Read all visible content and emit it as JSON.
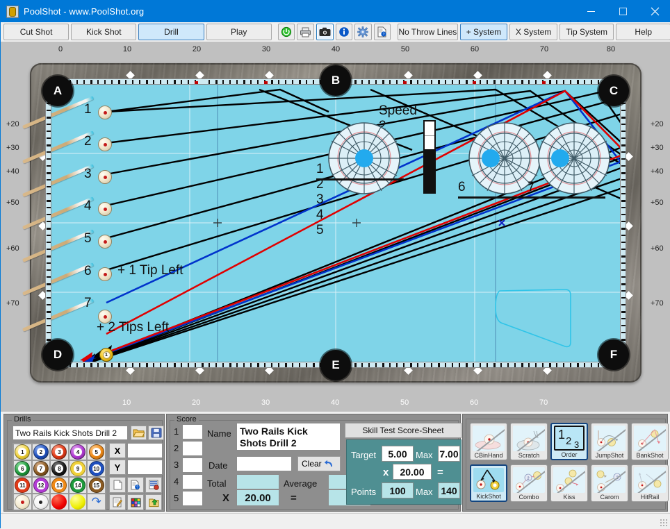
{
  "window": {
    "title": "PoolShot - www.PoolShot.org",
    "icon": "app-icon",
    "minimize": "–",
    "maximize": "□",
    "close": "✕"
  },
  "toolbar": {
    "tabs": [
      {
        "label": "Cut Shot",
        "selected": false
      },
      {
        "label": "Kick Shot",
        "selected": false
      },
      {
        "label": "Drill",
        "selected": true
      },
      {
        "label": "Play",
        "selected": false
      }
    ],
    "icons": [
      {
        "name": "power-icon",
        "glyph": "⏻",
        "color": "#19a519"
      },
      {
        "name": "printer-icon",
        "glyph": "⎙",
        "color": "#54585c"
      },
      {
        "name": "camera-icon",
        "glyph": "▣",
        "color": "#222222",
        "selected": true
      },
      {
        "name": "info-icon",
        "glyph": "i",
        "color": "#0a58c7"
      },
      {
        "name": "gear-icon",
        "glyph": "⚙",
        "color": "#4f7fd0"
      },
      {
        "name": "document-help-icon",
        "glyph": "?",
        "color": "#1b63c4"
      }
    ],
    "options": [
      {
        "label": "No Throw Lines",
        "selected": false
      },
      {
        "label": "+ System",
        "selected": true
      },
      {
        "label": "X System",
        "selected": false
      },
      {
        "label": "Tip System",
        "selected": false
      },
      {
        "label": "Help",
        "selected": false
      }
    ]
  },
  "table": {
    "ruler_top": [
      "0",
      "10",
      "20",
      "30",
      "40",
      "50",
      "60",
      "70",
      "80"
    ],
    "ruler_bottom": [
      "10",
      "20",
      "30",
      "40",
      "50",
      "60",
      "70"
    ],
    "ruler_left": [
      "+20",
      "+30",
      "+40",
      "+50",
      "+60",
      "+70"
    ],
    "ruler_right": [
      "+20",
      "+30",
      "+40",
      "+50",
      "+60",
      "+70"
    ],
    "pockets": [
      "A",
      "B",
      "C",
      "D",
      "E",
      "F"
    ],
    "cloth_color": "#7fd4e8",
    "rail_color": "#cfeaf2",
    "balls": [
      {
        "num": "1"
      },
      {
        "num": "2"
      },
      {
        "num": "3"
      },
      {
        "num": "4"
      },
      {
        "num": "5"
      },
      {
        "num": "6"
      },
      {
        "num": "7"
      }
    ],
    "object_ball": "1",
    "annotations": [
      {
        "text": "+ 1 Tip Left"
      },
      {
        "text": "+ 2 Tips Left"
      }
    ],
    "speed": {
      "label": "Speed 2",
      "value": 2,
      "max": 5
    },
    "spin_groups": [
      {
        "numbers": "1 2 3 4 5"
      },
      {
        "numbers": "6"
      },
      {
        "numbers": "7"
      }
    ],
    "line_colors": {
      "primary": "#000000",
      "alt1": "#0033cc",
      "alt2": "#e00000",
      "ghost": "#2fc4e8"
    }
  },
  "drills": {
    "group_label": "Drills",
    "name_value": "Two Rails Kick Shots Drill 2",
    "open_icon": "folder-open-icon",
    "save_icon": "floppy-save-icon",
    "balls": [
      {
        "label": "1",
        "color": "#f0d23c",
        "stripe": false
      },
      {
        "label": "2",
        "color": "#1f4fbe",
        "stripe": false
      },
      {
        "label": "3",
        "color": "#e03a18",
        "stripe": false
      },
      {
        "label": "4",
        "color": "#b23bd4",
        "stripe": false
      },
      {
        "label": "5",
        "color": "#f08a18",
        "stripe": false
      },
      {
        "label": "6",
        "color": "#1f9a3c",
        "stripe": false
      },
      {
        "label": "7",
        "color": "#8a5a22",
        "stripe": false
      },
      {
        "label": "8",
        "color": "#1c1c1c",
        "stripe": false
      },
      {
        "label": "9",
        "color": "#f0d23c",
        "stripe": true
      },
      {
        "label": "10",
        "color": "#1f4fbe",
        "stripe": true
      },
      {
        "label": "11",
        "color": "#e03a18",
        "stripe": true
      },
      {
        "label": "12",
        "color": "#b23bd4",
        "stripe": true
      },
      {
        "label": "13",
        "color": "#f08a18",
        "stripe": true
      },
      {
        "label": "14",
        "color": "#1f9a3c",
        "stripe": true
      },
      {
        "label": "15",
        "color": "#8a5a22",
        "stripe": true
      },
      {
        "label": "",
        "color": "#fdf6e0",
        "stripe": false
      },
      {
        "label": "",
        "color": "#f6f6f6",
        "stripe": false
      },
      {
        "label": "",
        "color": "#ee0000",
        "stripe": false
      },
      {
        "label": "",
        "color": "#eeee00",
        "stripe": false
      },
      {
        "label": "↷",
        "color": "#dcdcdc",
        "stripe": false
      }
    ],
    "x_label": "X",
    "y_label": "Y",
    "x_value": "",
    "y_value": "",
    "tools": [
      {
        "name": "new-document-icon"
      },
      {
        "name": "document-help-icon"
      },
      {
        "name": "table-report-icon"
      },
      {
        "name": "edit-note-icon"
      },
      {
        "name": "color-palette-icon"
      },
      {
        "name": "export-folder-icon"
      }
    ]
  },
  "score": {
    "group_label": "Score",
    "rows": [
      "1",
      "2",
      "3",
      "4",
      "5"
    ],
    "row_values": [
      "",
      "",
      "",
      "",
      ""
    ],
    "name_label": "Name",
    "name_value": "Two Rails Kick Shots Drill 2",
    "date_label": "Date",
    "date_value": "",
    "clear_label": "Clear",
    "clear_icon": "undo-arrow-icon",
    "total_label": "Total",
    "total_value": "",
    "average_label": "Average",
    "average_value": "",
    "multiply_label": "X",
    "multiplier_value": "20.00",
    "equals_label": "=",
    "result_value": ""
  },
  "skill_test": {
    "title": "Skill Test Score-Sheet",
    "target_label": "Target",
    "target_value": "5.00",
    "target_max_label": "Max",
    "target_max_value": "7.00",
    "multiply_label": "x",
    "multiplier_value": "20.00",
    "equals_label": "=",
    "points_label": "Points",
    "points_value": "100",
    "points_max_label": "Max",
    "points_max_value": "140",
    "panel_color": "#4f8f92"
  },
  "shot_types": [
    {
      "label": "CBinHand",
      "selected": false,
      "disabled": true
    },
    {
      "label": "Scratch",
      "selected": false,
      "disabled": true
    },
    {
      "label": "Order",
      "selected": true,
      "disabled": false
    },
    {
      "label": "JumpShot",
      "selected": false,
      "disabled": true
    },
    {
      "label": "BankShot",
      "selected": false,
      "disabled": true
    },
    {
      "label": "KickShot",
      "selected": true,
      "disabled": false
    },
    {
      "label": "Combo",
      "selected": false,
      "disabled": true
    },
    {
      "label": "Kiss",
      "selected": false,
      "disabled": true
    },
    {
      "label": "Carom",
      "selected": false,
      "disabled": true
    },
    {
      "label": "HitRail",
      "selected": false,
      "disabled": true
    }
  ]
}
